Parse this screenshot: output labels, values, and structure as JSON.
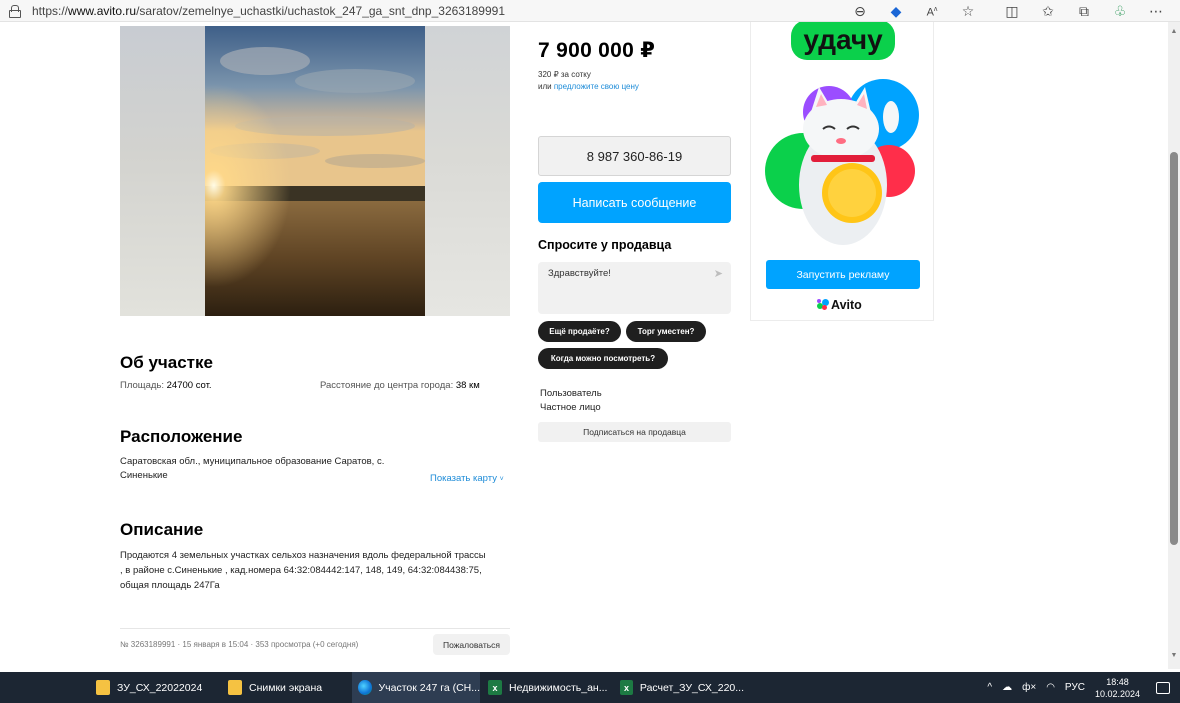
{
  "browser": {
    "url_prefix": "https://",
    "url_domain": "www.avito.ru",
    "url_path": "/saratov/zemelnye_uchastki/uchastok_247_ga_snt_dnp_3263189991",
    "icons": [
      "lock-icon",
      "zoom-icon",
      "tag-icon",
      "read-aloud-icon",
      "favorite-icon",
      "split-screen-icon",
      "favorites-bar-icon",
      "collections-icon",
      "extension-icon",
      "more-icon"
    ]
  },
  "listing": {
    "price": "7 900 000 ₽",
    "price_per": "320 ₽ за сотку",
    "offer_prefix": "или ",
    "offer_link": "предложите свою цену",
    "phone": "8 987 360-86-19",
    "write_message": "Написать сообщение",
    "ask_title": "Спросите у продавца",
    "ask_placeholder": "Здравствуйте!",
    "chips": [
      "Ещё продаёте?",
      "Торг уместен?",
      "Когда можно посмотреть?"
    ],
    "seller_name": "Пользователь",
    "seller_type": "Частное лицо",
    "subscribe": "Подписаться на продавца"
  },
  "about": {
    "title": "Об участке",
    "area_label": "Площадь: ",
    "area_value": "24700 сот.",
    "distance_label": "Расстояние до центра города: ",
    "distance_value": "38 км"
  },
  "location": {
    "title": "Расположение",
    "address": "Саратовская обл., муниципальное образование Саратов, с. Синенькие",
    "show_map": "Показать карту"
  },
  "description": {
    "title": "Описание",
    "text": "Продаются 4 земельных участках сельхоз назначения вдоль федеральной трассы , в районе с.Синенькие , кад.номера 64:32:084442:147, 148, 149, 64:32:084438:75, общая площадь 247Га"
  },
  "footer": {
    "meta": "№ 3263189991 · 15 января в 15:04 · 353 просмотра (+0 сегодня)",
    "report": "Пожаловаться"
  },
  "ad": {
    "headline": "удачу",
    "button": "Запустить рекламу",
    "logo": "Avito"
  },
  "taskbar": {
    "items": [
      {
        "label": "ЗУ_СХ_22022024",
        "icon": "folder-icon"
      },
      {
        "label": "Снимки экрана",
        "icon": "folder-icon"
      },
      {
        "label": "Участок 247 га (СН...",
        "icon": "edge-icon"
      },
      {
        "label": "Недвижимость_ан...",
        "icon": "excel-icon"
      },
      {
        "label": "Расчет_ЗУ_СХ_220...",
        "icon": "excel-icon"
      }
    ],
    "language": "РУС",
    "time": "18:48",
    "date": "10.02.2024"
  }
}
